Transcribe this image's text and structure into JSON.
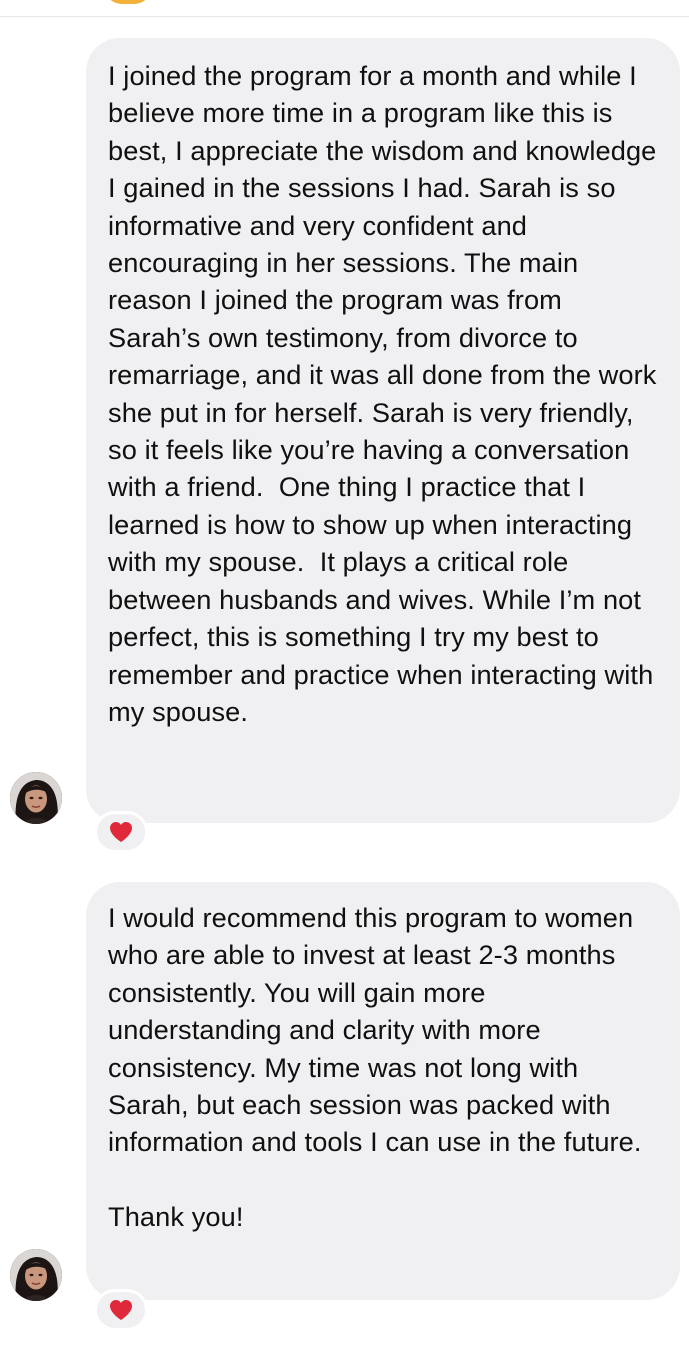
{
  "conversation": {
    "messages": [
      {
        "sender_avatar": "user-avatar",
        "paragraphs": [
          "I joined the program for a month and while I believe more time in a program like this is best, I appreciate the wisdom and knowledge I gained in the sessions I had. Sarah is so informative and very confident and encouraging in her sessions. The main reason I joined the program was from Sarah’s own testimony, from divorce to remarriage, and it was all done from the work she put in for herself. Sarah is very friendly, so it feels like you’re having a conversation with a friend.  One thing I practice that I learned is how to show up when interacting with my spouse.  It plays a critical role between husbands and wives. While I’m not perfect, this is something I try my best to remember and practice when interacting with my spouse."
        ],
        "reaction": "heart-icon"
      },
      {
        "sender_avatar": "user-avatar",
        "paragraphs": [
          "I would recommend this program to women who are able to invest at least 2-3 months consistently. You will gain more understanding and clarity with more consistency. My time was not long with Sarah, but each session was packed with information and tools I can use in the future.",
          "Thank you!"
        ],
        "reaction": "heart-icon"
      }
    ]
  },
  "colors": {
    "bubble_background": "#f0f0f2",
    "text": "#101010",
    "heart": "#e0283b",
    "page_background": "#ffffff"
  }
}
